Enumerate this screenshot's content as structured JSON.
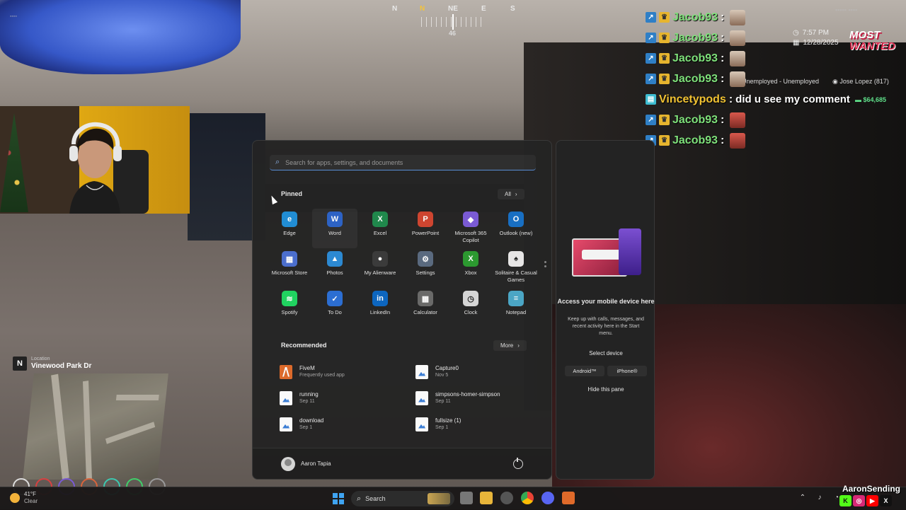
{
  "compass": {
    "directions": [
      "N",
      "N",
      "NE",
      "E",
      "S"
    ],
    "heading": "46"
  },
  "hud": {
    "time": "7:57 PM",
    "date": "12/28/2025",
    "logo_line1": "MOST",
    "logo_line2": "WANTED",
    "job": "Unemployed - Unemployed",
    "player": "Jose Lopez (817)",
    "money": "$64,685",
    "location_label": "Location",
    "location_value": "Vinewood Park Dr",
    "location_dir": "N"
  },
  "chat": [
    {
      "name": "Jacob93",
      "sep": ":",
      "message": "",
      "name_color": "#7ee07a",
      "emote": "face"
    },
    {
      "name": "Jacob93",
      "sep": ":",
      "message": "",
      "name_color": "#7ee07a",
      "emote": "face"
    },
    {
      "name": "Jacob93",
      "sep": ":",
      "message": "",
      "name_color": "#7ee07a",
      "emote": "face"
    },
    {
      "name": "Jacob93",
      "sep": ":",
      "message": "",
      "name_color": "#7ee07a",
      "emote": "face"
    },
    {
      "name": "Vincetypods",
      "sep": ":",
      "message": "did u see my comment",
      "name_color": "#f1c232",
      "emote": ""
    },
    {
      "name": "Jacob93",
      "sep": ":",
      "message": "",
      "name_color": "#7ee07a",
      "emote": "red"
    },
    {
      "name": "Jacob93",
      "sep": ":",
      "message": "",
      "name_color": "#7ee07a",
      "emote": "red"
    }
  ],
  "start_menu": {
    "search_placeholder": "Search for apps, settings, and documents",
    "pinned_title": "Pinned",
    "all_button": "All",
    "pinned": [
      {
        "label": "Edge",
        "icon": "edge-icon",
        "color": "#1f8fd8",
        "glyph": "e"
      },
      {
        "label": "Word",
        "icon": "word-icon",
        "color": "#2b63c9",
        "glyph": "W"
      },
      {
        "label": "Excel",
        "icon": "excel-icon",
        "color": "#1e8a4c",
        "glyph": "X"
      },
      {
        "label": "PowerPoint",
        "icon": "powerpoint-icon",
        "color": "#d2452f",
        "glyph": "P"
      },
      {
        "label": "Microsoft 365 Copilot",
        "icon": "m365-copilot-icon",
        "color": "#7b5ad8",
        "glyph": "◆"
      },
      {
        "label": "Outlook (new)",
        "icon": "outlook-icon",
        "color": "#1670c7",
        "glyph": "O"
      },
      {
        "label": "Microsoft Store",
        "icon": "store-icon",
        "color": "#4a6fd1",
        "glyph": "▦"
      },
      {
        "label": "Photos",
        "icon": "photos-icon",
        "color": "#2a8bd6",
        "glyph": "▲"
      },
      {
        "label": "My Alienware",
        "icon": "alienware-icon",
        "color": "#3a3a3a",
        "glyph": "●"
      },
      {
        "label": "Settings",
        "icon": "settings-icon",
        "color": "#5a6b80",
        "glyph": "⚙"
      },
      {
        "label": "Xbox",
        "icon": "xbox-icon",
        "color": "#2a9b2f",
        "glyph": "X"
      },
      {
        "label": "Solitaire & Casual Games",
        "icon": "solitaire-icon",
        "color": "#eaeaea",
        "glyph": "♠"
      },
      {
        "label": "Spotify",
        "icon": "spotify-icon",
        "color": "#1ed760",
        "glyph": "≋"
      },
      {
        "label": "To Do",
        "icon": "todo-icon",
        "color": "#2a6fd6",
        "glyph": "✓"
      },
      {
        "label": "LinkedIn",
        "icon": "linkedin-icon",
        "color": "#0a66c2",
        "glyph": "in"
      },
      {
        "label": "Calculator",
        "icon": "calculator-icon",
        "color": "#6a6a6a",
        "glyph": "▦"
      },
      {
        "label": "Clock",
        "icon": "clock-icon",
        "color": "#d9d9d9",
        "glyph": "◷"
      },
      {
        "label": "Notepad",
        "icon": "notepad-icon",
        "color": "#4aa8c9",
        "glyph": "≡"
      }
    ],
    "recommended_title": "Recommended",
    "more_button": "More",
    "recommended": [
      {
        "title": "FiveM",
        "sub": "Frequently used app",
        "kind": "fivem"
      },
      {
        "title": "Capture0",
        "sub": "Nov 5",
        "kind": "image"
      },
      {
        "title": "running",
        "sub": "Sep 11",
        "kind": "image"
      },
      {
        "title": "simpsons-homer-simpson",
        "sub": "Sep 11",
        "kind": "image"
      },
      {
        "title": "download",
        "sub": "Sep 1",
        "kind": "image"
      },
      {
        "title": "fullsize (1)",
        "sub": "Sep 1",
        "kind": "image"
      }
    ],
    "user_name": "Aaron Tapia"
  },
  "phone_panel": {
    "title": "Access your mobile device here",
    "description": "Keep up with calls, messages, and recent activity here in the Start menu.",
    "select_device": "Select device",
    "android": "Android™",
    "iphone": "iPhone®",
    "hide": "Hide this pane"
  },
  "taskbar": {
    "temp": "41°F",
    "condition": "Clear",
    "search": "Search"
  },
  "overlay": {
    "brand": "AaronSending"
  }
}
